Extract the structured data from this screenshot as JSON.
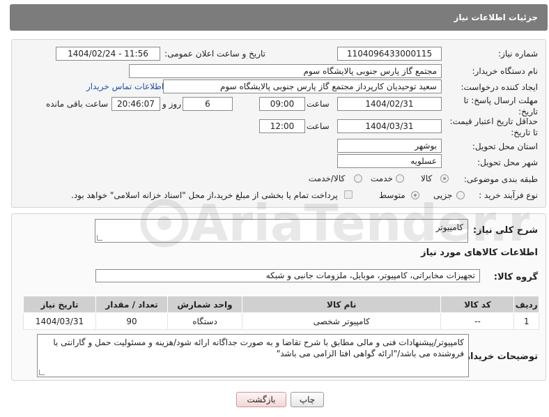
{
  "header": {
    "title": "جزئیات اطلاعات نیاز"
  },
  "form": {
    "need_number": {
      "label": "شماره نیاز:",
      "value": "1104096433000115"
    },
    "announce_date": {
      "label": "تاریخ و ساعت اعلان عمومی:",
      "value": "1404/02/24 - 11:56"
    },
    "buyer_org": {
      "label": "نام دستگاه خریدار:",
      "value": "مجتمع گاز پارس جنوبی  پالایشگاه سوم"
    },
    "requester": {
      "label": "ایجاد کننده درخواست:",
      "value": "سعید توحیدیان کارپرداز مجتمع گاز پارس جنوبی  پالایشگاه سوم",
      "contact_link": "اطلاعات تماس خریدار"
    },
    "reply_deadline": {
      "label": "مهلت ارسال پاسخ: تا تاریخ:",
      "date": "1404/02/31",
      "time_label": "ساعت",
      "time": "09:00",
      "days": "6",
      "days_label": "روز و",
      "remaining": "20:46:07",
      "remaining_label": "ساعت باقی مانده"
    },
    "price_validity": {
      "label": "حداقل تاریخ اعتبار قیمت: تا تاریخ:",
      "date": "1404/03/31",
      "time_label": "ساعت",
      "time": "12:00"
    },
    "province": {
      "label": "استان محل تحویل:",
      "value": "بوشهر"
    },
    "city": {
      "label": "شهر محل تحویل:",
      "value": "عسلویه"
    },
    "category": {
      "label": "طبقه بندی موضوعی:",
      "options": [
        "کالا",
        "خدمت",
        "کالا/خدمت"
      ],
      "selected": "کالا"
    },
    "process": {
      "label": "نوع فرآیند خرید :",
      "options": [
        "جزیی",
        "متوسط"
      ],
      "selected": "متوسط",
      "payment_note": "پرداخت تمام یا بخشی از مبلغ خرید،از محل \"اسناد خزانه اسلامی\" خواهد بود."
    }
  },
  "details": {
    "summary_label": "شرح کلی نیاز:",
    "summary_value": "کامپیوتر",
    "goods_info_title": "اطلاعات کالاهای مورد نیاز",
    "group_label": "گروه کالا:",
    "group_value": "تجهیزات مخابراتی، کامپیوتر، موبایل، ملزومات جانبی و شبکه",
    "table": {
      "headers": [
        "ردیف",
        "کد کالا",
        "نام کالا",
        "واحد شمارش",
        "تعداد / مقدار",
        "تاریخ نیاز"
      ],
      "rows": [
        [
          "1",
          "--",
          "کامپیوتر شخصی",
          "دستگاه",
          "90",
          "1404/03/31"
        ]
      ]
    },
    "buyer_notes_label": "توضیحات خریدار:",
    "buyer_notes_value": "کامپیوتر/پیشنهادات فنی و مالی مطابق با شرح تقاضا و به صورت جداگانه ارائه شود/هزینه و مسئولیت حمل و گارانتی با فروشنده می باشد/\"ارائه گواهی افتا الزامی می باشد\""
  },
  "buttons": {
    "print": "چاپ",
    "back": "بازگشت"
  },
  "watermark": {
    "text": "AriaTender.neT"
  },
  "colors": {
    "header_bg": "#7c7c7c",
    "link": "#1f4fa8",
    "table_header": "#d0d0d0"
  }
}
